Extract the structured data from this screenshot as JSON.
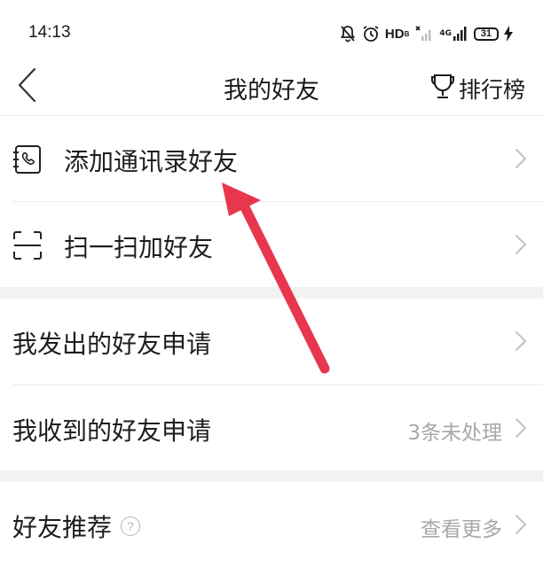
{
  "status_bar": {
    "time": "14:13",
    "network_label": "HD",
    "network_sub": "B",
    "signal_label": "4G",
    "battery": "31"
  },
  "nav": {
    "title": "我的好友",
    "ranking_label": "排行榜"
  },
  "rows": {
    "add_contacts": {
      "label": "添加通讯录好友"
    },
    "scan_add": {
      "label": "扫一扫加好友"
    },
    "sent_requests": {
      "label": "我发出的好友申请"
    },
    "received_requests": {
      "label": "我收到的好友申请",
      "value": "3条未处理"
    },
    "recommend": {
      "label": "好友推荐",
      "help": "?",
      "value": "查看更多"
    }
  },
  "colors": {
    "arrow": "#e8364f",
    "divider": "#ececec",
    "section_gap": "#f2f2f2",
    "secondary_text": "#a8a8a8"
  },
  "icons": {
    "back": "chevron-left-icon",
    "ranking": "trophy-icon",
    "contacts": "phone-book-icon",
    "scan": "scan-frame-icon",
    "help": "question-circle-icon",
    "chevron": "chevron-right-icon"
  }
}
